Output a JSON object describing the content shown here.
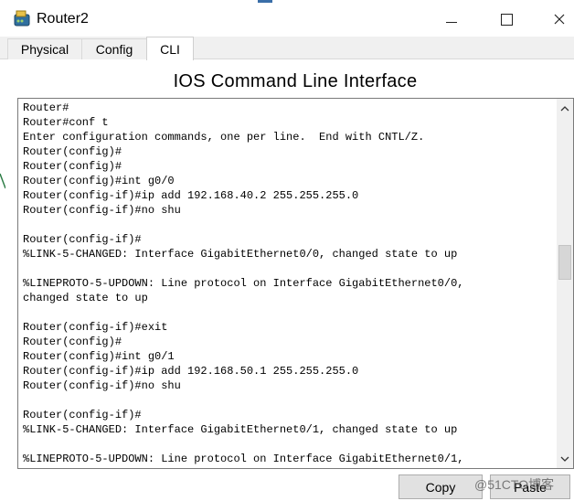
{
  "window": {
    "title": "Router2",
    "minimize_label": "—",
    "maximize_label": "☐",
    "close_label": "✕"
  },
  "tabs": [
    {
      "label": "Physical",
      "active": false
    },
    {
      "label": "Config",
      "active": false
    },
    {
      "label": "CLI",
      "active": true
    }
  ],
  "heading": "IOS Command Line Interface",
  "terminal": {
    "lines": [
      "Router#",
      "Router#conf t",
      "Enter configuration commands, one per line.  End with CNTL/Z.",
      "Router(config)#",
      "Router(config)#",
      "Router(config)#int g0/0",
      "Router(config-if)#ip add 192.168.40.2 255.255.255.0",
      "Router(config-if)#no shu",
      "",
      "Router(config-if)#",
      "%LINK-5-CHANGED: Interface GigabitEthernet0/0, changed state to up",
      "",
      "%LINEPROTO-5-UPDOWN: Line protocol on Interface GigabitEthernet0/0,",
      "changed state to up",
      "",
      "Router(config-if)#exit",
      "Router(config)#",
      "Router(config)#int g0/1",
      "Router(config-if)#ip add 192.168.50.1 255.255.255.0",
      "Router(config-if)#no shu",
      "",
      "Router(config-if)#",
      "%LINK-5-CHANGED: Interface GigabitEthernet0/1, changed state to up",
      "",
      "%LINEPROTO-5-UPDOWN: Line protocol on Interface GigabitEthernet0/1,"
    ]
  },
  "buttons": {
    "copy": "Copy",
    "paste": "Paste"
  },
  "watermark": "@51CTO博客",
  "icons": {
    "app": "router-icon",
    "scroll_up": "chevron-up-icon",
    "scroll_down": "chevron-down-icon"
  }
}
